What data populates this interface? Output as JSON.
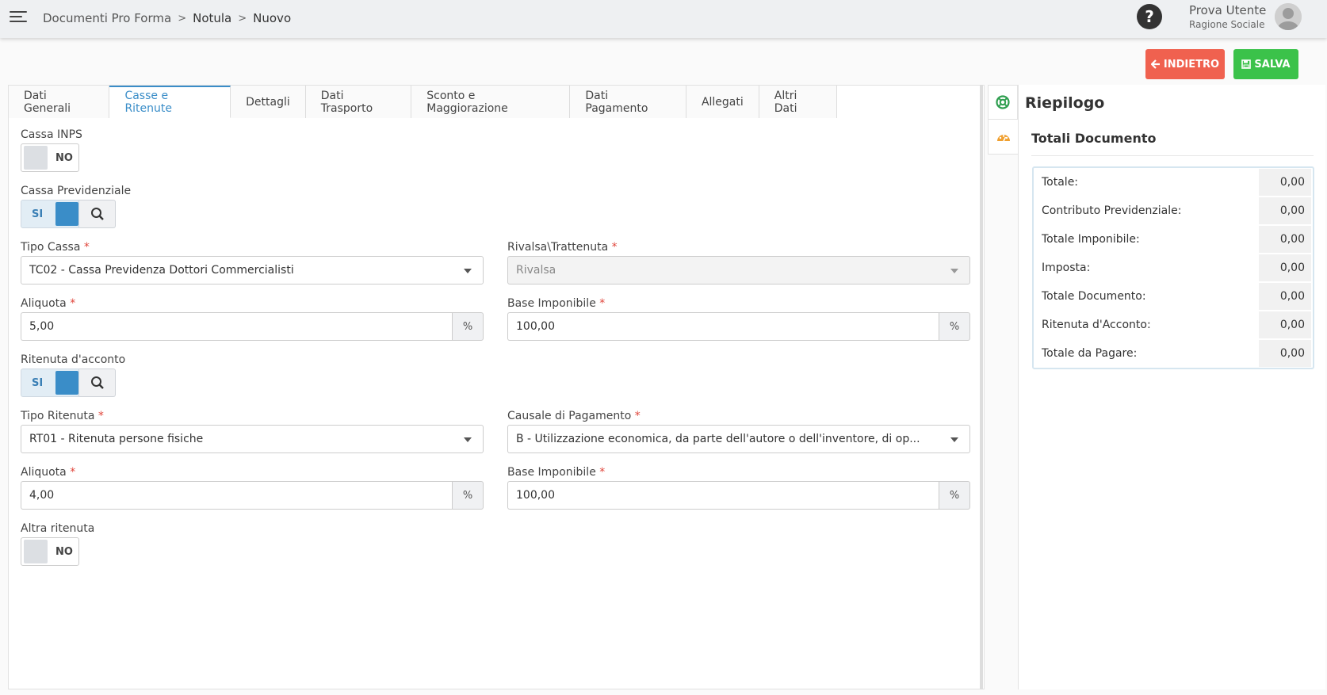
{
  "breadcrumb": [
    "Documenti Pro Forma",
    "Notula",
    "Nuovo"
  ],
  "user": {
    "name": "Prova Utente",
    "company": "Ragione Sociale"
  },
  "help": {
    "label": "?"
  },
  "actions": {
    "back_label": "INDIETRO",
    "save_label": "SALVA"
  },
  "tabs": [
    "Dati Generali",
    "Casse e Ritenute",
    "Dettagli",
    "Dati Trasporto",
    "Sconto e Maggiorazione",
    "Dati Pagamento",
    "Allegati",
    "Altri Dati"
  ],
  "active_tab": "Casse e Ritenute",
  "form": {
    "cassa_inps": {
      "label": "Cassa INPS",
      "value": "NO"
    },
    "cassa_previdenziale": {
      "label": "Cassa Previdenziale",
      "value": "SI"
    },
    "tipo_cassa": {
      "label": "Tipo Cassa",
      "value": "TC02 - Cassa Previdenza Dottori Commercialisti"
    },
    "rivalsa_trattenuta": {
      "label": "Rivalsa\\Trattenuta",
      "value": "Rivalsa"
    },
    "aliquota_cassa": {
      "label": "Aliquota",
      "value": "5,00",
      "unit": "%"
    },
    "base_imponibile_cassa": {
      "label": "Base Imponibile",
      "value": "100,00",
      "unit": "%"
    },
    "ritenuta_acconto": {
      "label": "Ritenuta d'acconto",
      "value": "SI"
    },
    "tipo_ritenuta": {
      "label": "Tipo Ritenuta",
      "value": "RT01 - Ritenuta persone fisiche"
    },
    "causale_pagamento": {
      "label": "Causale di Pagamento",
      "value": "B - Utilizzazione economica, da parte dell'autore o dell'inventore, di op..."
    },
    "aliquota_ritenuta": {
      "label": "Aliquota",
      "value": "4,00",
      "unit": "%"
    },
    "base_imponibile_ritenuta": {
      "label": "Base Imponibile",
      "value": "100,00",
      "unit": "%"
    },
    "altra_ritenuta": {
      "label": "Altra ritenuta",
      "value": "NO"
    }
  },
  "riepilogo": {
    "title": "Riepilogo",
    "section_title": "Totali Documento",
    "rows": [
      {
        "label": "Totale:",
        "value": "0,00"
      },
      {
        "label": "Contributo Previdenziale:",
        "value": "0,00"
      },
      {
        "label": "Totale Imponibile:",
        "value": "0,00"
      },
      {
        "label": "Imposta:",
        "value": "0,00"
      },
      {
        "label": "Totale Documento:",
        "value": "0,00"
      },
      {
        "label": "Ritenuta d'Acconto:",
        "value": "0,00"
      },
      {
        "label": "Totale da Pagare:",
        "value": "0,00"
      }
    ]
  },
  "colors": {
    "accent": "#3a8dc8",
    "back": "#f0614f",
    "save": "#3bc24a",
    "required": "#e0453b"
  }
}
